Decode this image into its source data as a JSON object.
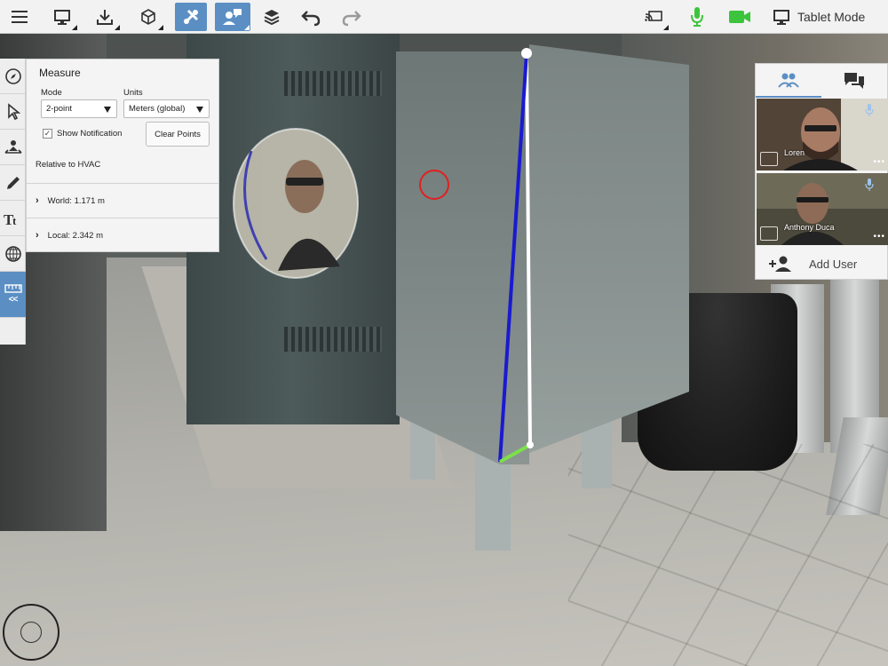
{
  "toolbar": {
    "tablet_mode_label": "Tablet Mode"
  },
  "measure": {
    "title": "Measure",
    "mode_label": "Mode",
    "mode_value": "2-point",
    "units_label": "Units",
    "units_value": "Meters (global)",
    "show_notification_label": "Show Notification",
    "show_notification_checked": true,
    "clear_points_label": "Clear Points",
    "relative_label": "Relative to HVAC",
    "world_label": "World: 1.171 m",
    "local_label": "Local: 2.342 m"
  },
  "call": {
    "participants": [
      {
        "name": "Loren"
      },
      {
        "name": "Anthony Duca"
      }
    ],
    "add_user_label": "Add User"
  },
  "colors": {
    "accent": "#5b8fc4",
    "mic_active": "#3cc43c",
    "camera_active": "#3cc43c",
    "measure_line": "#1a1ad0",
    "measure_vertical": "#ffffff",
    "measure_horizontal": "#7ce04a",
    "annotation_circle": "#e02020"
  },
  "icons": {
    "menu": "hamburger-icon",
    "screen": "monitor-icon",
    "download": "download-icon",
    "model": "cube-icon",
    "tools": "tools-icon",
    "collaborate": "collaborate-icon",
    "layers": "layers-icon",
    "undo": "undo-icon",
    "redo": "redo-icon",
    "cast": "cast-icon",
    "mic": "microphone-icon",
    "camera": "video-camera-icon",
    "tablet": "tablet-icon"
  }
}
